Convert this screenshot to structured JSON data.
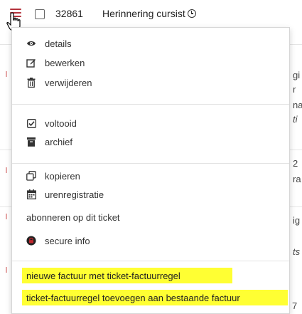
{
  "row": {
    "ticket_id": "32861",
    "ticket_title": "Herinnering cursist"
  },
  "menu": {
    "group1": [
      {
        "label": "details",
        "icon": "eye-icon"
      },
      {
        "label": "bewerken",
        "icon": "edit-icon"
      },
      {
        "label": "verwijderen",
        "icon": "trash-icon"
      }
    ],
    "group2": [
      {
        "label": "voltooid",
        "icon": "checked-box-icon"
      },
      {
        "label": "archief",
        "icon": "archive-icon"
      }
    ],
    "group3": [
      {
        "label": "kopieren",
        "icon": "copy-icon"
      },
      {
        "label": "urenregistratie",
        "icon": "calendar-icon"
      },
      {
        "label": "abonneren op dit ticket",
        "icon": ""
      },
      {
        "label": "secure info",
        "icon": "lock-icon"
      }
    ],
    "highlighted": [
      {
        "label": "nieuwe factuur met ticket-factuurregel"
      },
      {
        "label": "ticket-factuurregel toevoegen aan bestaande factuur"
      }
    ]
  },
  "background": {
    "fragments": [
      "gi",
      "r",
      "na",
      "ti",
      "2",
      "ra",
      "ig",
      "ts",
      "7"
    ]
  },
  "colors": {
    "hamburger": "#b4333c",
    "highlight": "#ffff33"
  }
}
